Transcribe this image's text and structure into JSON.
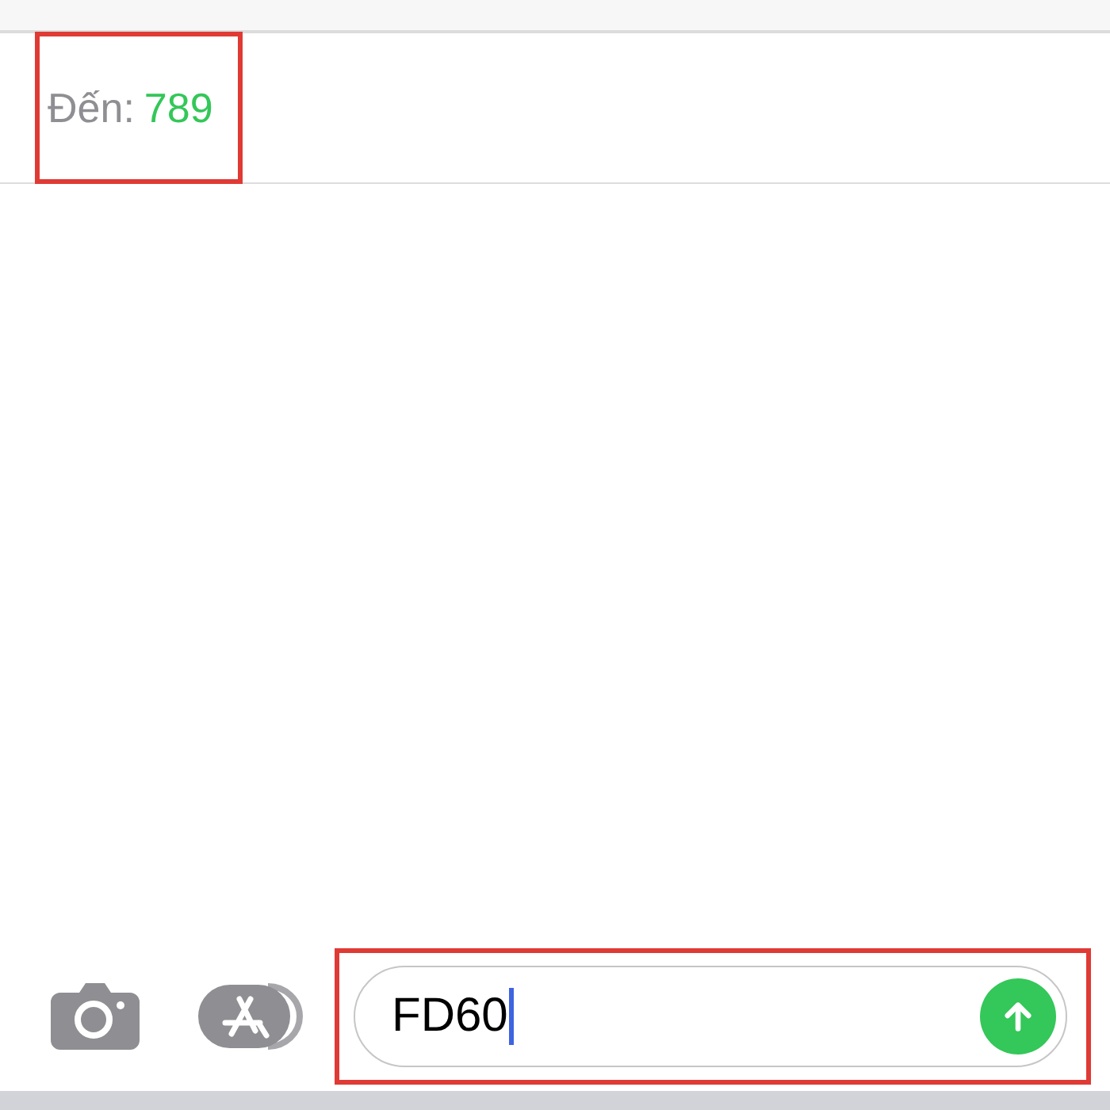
{
  "header": {
    "label": "Đến:",
    "recipient": "789"
  },
  "composer": {
    "value": "FD60"
  }
}
